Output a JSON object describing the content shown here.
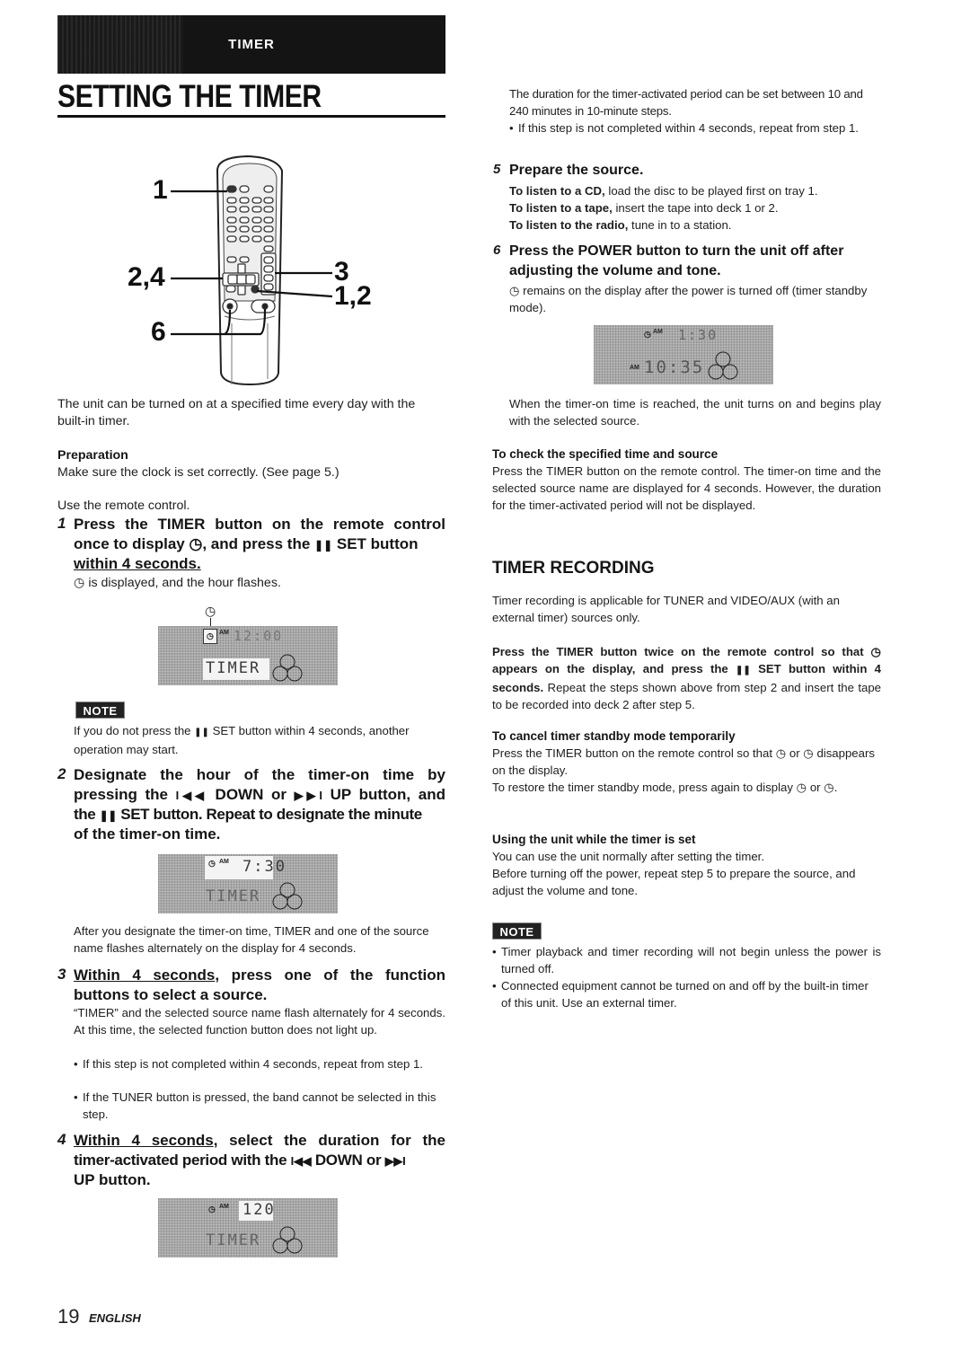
{
  "header": {
    "section_label": "TIMER",
    "title": "SETTING THE TIMER"
  },
  "remote_callouts": [
    "1",
    "2,4",
    "6",
    "3",
    "1,2"
  ],
  "intro": "The unit can be turned on at a specified time every day with the built-in timer.",
  "preparation": {
    "heading": "Preparation",
    "text": "Make sure the clock is set correctly. (See page 5.)"
  },
  "use_remote": "Use the remote control.",
  "icons": {
    "timer": "◷",
    "pause": "❚❚",
    "prev": "I◀◀",
    "next": "▶▶I"
  },
  "step1": {
    "num": "1",
    "line1": "Press the TIMER button on the remote control",
    "line2a": "once to display ",
    "line2b": ", and press the ",
    "line2c": " SET button",
    "line3": "within 4 seconds.",
    "desc": " is displayed, and the hour flashes.",
    "display": {
      "mode": "AM",
      "time": "12:00",
      "source": "TIMER"
    }
  },
  "note1": {
    "badge": "NOTE",
    "text_a": "If you do not press the ",
    "text_b": " SET button within 4 seconds, another operation may start."
  },
  "step2": {
    "num": "2",
    "line1": "Designate the hour of the timer-on time by",
    "line2a": "pressing the ",
    "line2b": " DOWN or ",
    "line2c": " UP button, and",
    "line3a": "the ",
    "line3b": " SET button. Repeat to designate the minute",
    "line4": "of the timer-on time.",
    "display": {
      "mode": "AM",
      "time": "7:30",
      "source": "TIMER"
    },
    "desc": "After you designate the timer-on time, TIMER and one of the source name flashes alternately on the display for 4 seconds."
  },
  "step3": {
    "num": "3",
    "line1a": "Within 4 seconds",
    "line1b": ", press one of the function",
    "line2": "buttons to select a source.",
    "desc": "“TIMER” and the selected source name flash alternately for 4 seconds.  At this time, the selected function button does not light up.",
    "bullets": [
      "If this step is not completed within 4 seconds, repeat from step 1.",
      "If the TUNER button is pressed, the band cannot be selected in this step."
    ]
  },
  "step4": {
    "num": "4",
    "line1a": "Within 4 seconds",
    "line1b": ", select the duration for the",
    "line2a": "timer-activated period with the ",
    "line2b": " DOWN or ",
    "line3": "UP button.",
    "display": {
      "mode": "AM",
      "duration": "120",
      "source": "TIMER"
    },
    "desc": "The duration for the timer-activated period can be set between 10 and 240 minutes in 10-minute steps.",
    "bullet": "If this step is not completed within 4 seconds, repeat from step 1."
  },
  "step5": {
    "num": "5",
    "heading": "Prepare the source.",
    "items": [
      {
        "bold": "To listen to a CD,",
        "text": " load the disc to be played first on tray 1."
      },
      {
        "bold": "To listen to a tape,",
        "text": " insert the tape into deck 1 or 2."
      },
      {
        "bold": "To listen to the radio,",
        "text": " tune in to a station."
      }
    ]
  },
  "step6": {
    "num": "6",
    "line1": "Press the POWER button to turn the unit off after",
    "line2": "adjusting the volume and tone.",
    "desc": " remains on the display after the power is turned off (timer standby mode).",
    "display": {
      "timer_mode": "AM",
      "timer_time": "1:30",
      "clock_mode": "AM",
      "clock_time": "10:35"
    },
    "after": "When the timer-on time is reached, the unit turns on and begins play with the selected source."
  },
  "check": {
    "heading": "To check the specified time and source",
    "text": "Press the TIMER button on the remote control. The timer-on time and the selected source name are displayed for 4 seconds. However, the duration for the timer-activated period will not be displayed."
  },
  "recording": {
    "heading": "TIMER RECORDING",
    "intro": "Timer recording is applicable for TUNER and VIDEO/AUX (with an external timer) sources only.",
    "bold_a": "Press the TIMER button twice on the remote control so that ",
    "bold_b": " appears on the display, and press the ",
    "bold_c": " SET button within 4 seconds.",
    "rest": "  Repeat the steps shown above from step 2 and insert the tape to be recorded into deck 2 after step 5.",
    "rec_icon": "◷"
  },
  "cancel": {
    "heading": "To cancel timer standby mode temporarily",
    "text_a": "Press the TIMER button on the remote control so that ",
    "text_b": " or ",
    "text_c": " disappears on the display.",
    "restore_a": "To restore the timer standby mode, press again to display ",
    "restore_b": " or ",
    "restore_c": "."
  },
  "using": {
    "heading": "Using the unit while the timer is set",
    "line1": "You can use the unit normally after setting the timer.",
    "line2": "Before turning off the power, repeat step 5 to prepare the source, and adjust the volume and tone."
  },
  "note2": {
    "badge": "NOTE",
    "bullets": [
      "Timer playback and timer recording will not begin unless the power is turned off.",
      "Connected equipment cannot be turned on and off by the built-in timer of this unit.  Use an external timer."
    ]
  },
  "footer": {
    "page_number": "19",
    "language": "ENGLISH"
  }
}
